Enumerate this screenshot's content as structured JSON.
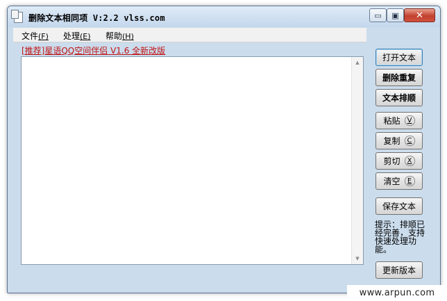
{
  "window": {
    "title": "删除文本相同项 V:2.2 vlss.com",
    "controls": {
      "minimize": "▭",
      "maximize": "▣",
      "close": "✕"
    }
  },
  "menu": [
    {
      "label": "文件",
      "key": "(F)"
    },
    {
      "label": "处理",
      "key": "(E)"
    },
    {
      "label": "帮助",
      "key": "(H)"
    }
  ],
  "promo_link": "[推荐]星语QQ空间伴侣 V1.6 全新改版",
  "editor": {
    "value": ""
  },
  "buttons": {
    "open_text": "打开文本",
    "remove_duplicates": "删除重复",
    "sort_text": "文本排顺",
    "paste": {
      "label": "粘贴",
      "key": "V"
    },
    "copy": {
      "label": "复制",
      "key": "C"
    },
    "cut": {
      "label": "剪切",
      "key": "X"
    },
    "clear": {
      "label": "清空",
      "key": "E"
    },
    "save_text": "保存文本",
    "update_version": "更新版本"
  },
  "hint": "提示：排顺已经完善，支持快速处理功能。",
  "watermark": "www.arpun.com",
  "icons": {
    "app": "document-icon",
    "scroll_up": "▲",
    "scroll_down": "▼"
  }
}
